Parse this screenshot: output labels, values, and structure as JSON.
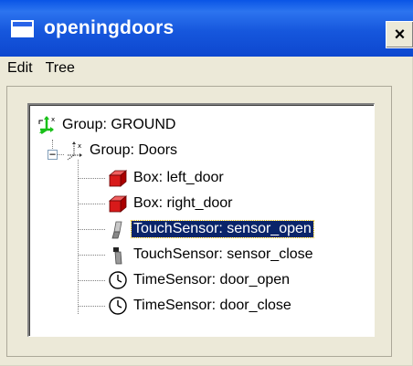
{
  "window": {
    "title": "openingdoors",
    "close_symbol": "×"
  },
  "menu": [
    "Edit",
    "Tree"
  ],
  "tree": {
    "root": {
      "label": "Group:  GROUND",
      "icon": "group-axes-green-icon"
    },
    "doors": {
      "label": "Group:  Doors",
      "icon": "group-axes-icon",
      "expander": "−"
    },
    "children": [
      {
        "label": "Box:  left_door",
        "icon": "box-icon"
      },
      {
        "label": "Box:  right_door",
        "icon": "box-icon"
      },
      {
        "label": "TouchSensor:  sensor_open",
        "icon": "touch-sensor-icon",
        "selected": true
      },
      {
        "label": "TouchSensor:  sensor_close",
        "icon": "touch-sensor-icon"
      },
      {
        "label": "TimeSensor:  door_open",
        "icon": "clock-icon"
      },
      {
        "label": "TimeSensor:  door_close",
        "icon": "clock-icon"
      }
    ]
  },
  "colors": {
    "titlebar": "#0d47cf",
    "selection": "#0a246a",
    "box": "#d81a1a",
    "root_group": "#18c018"
  }
}
